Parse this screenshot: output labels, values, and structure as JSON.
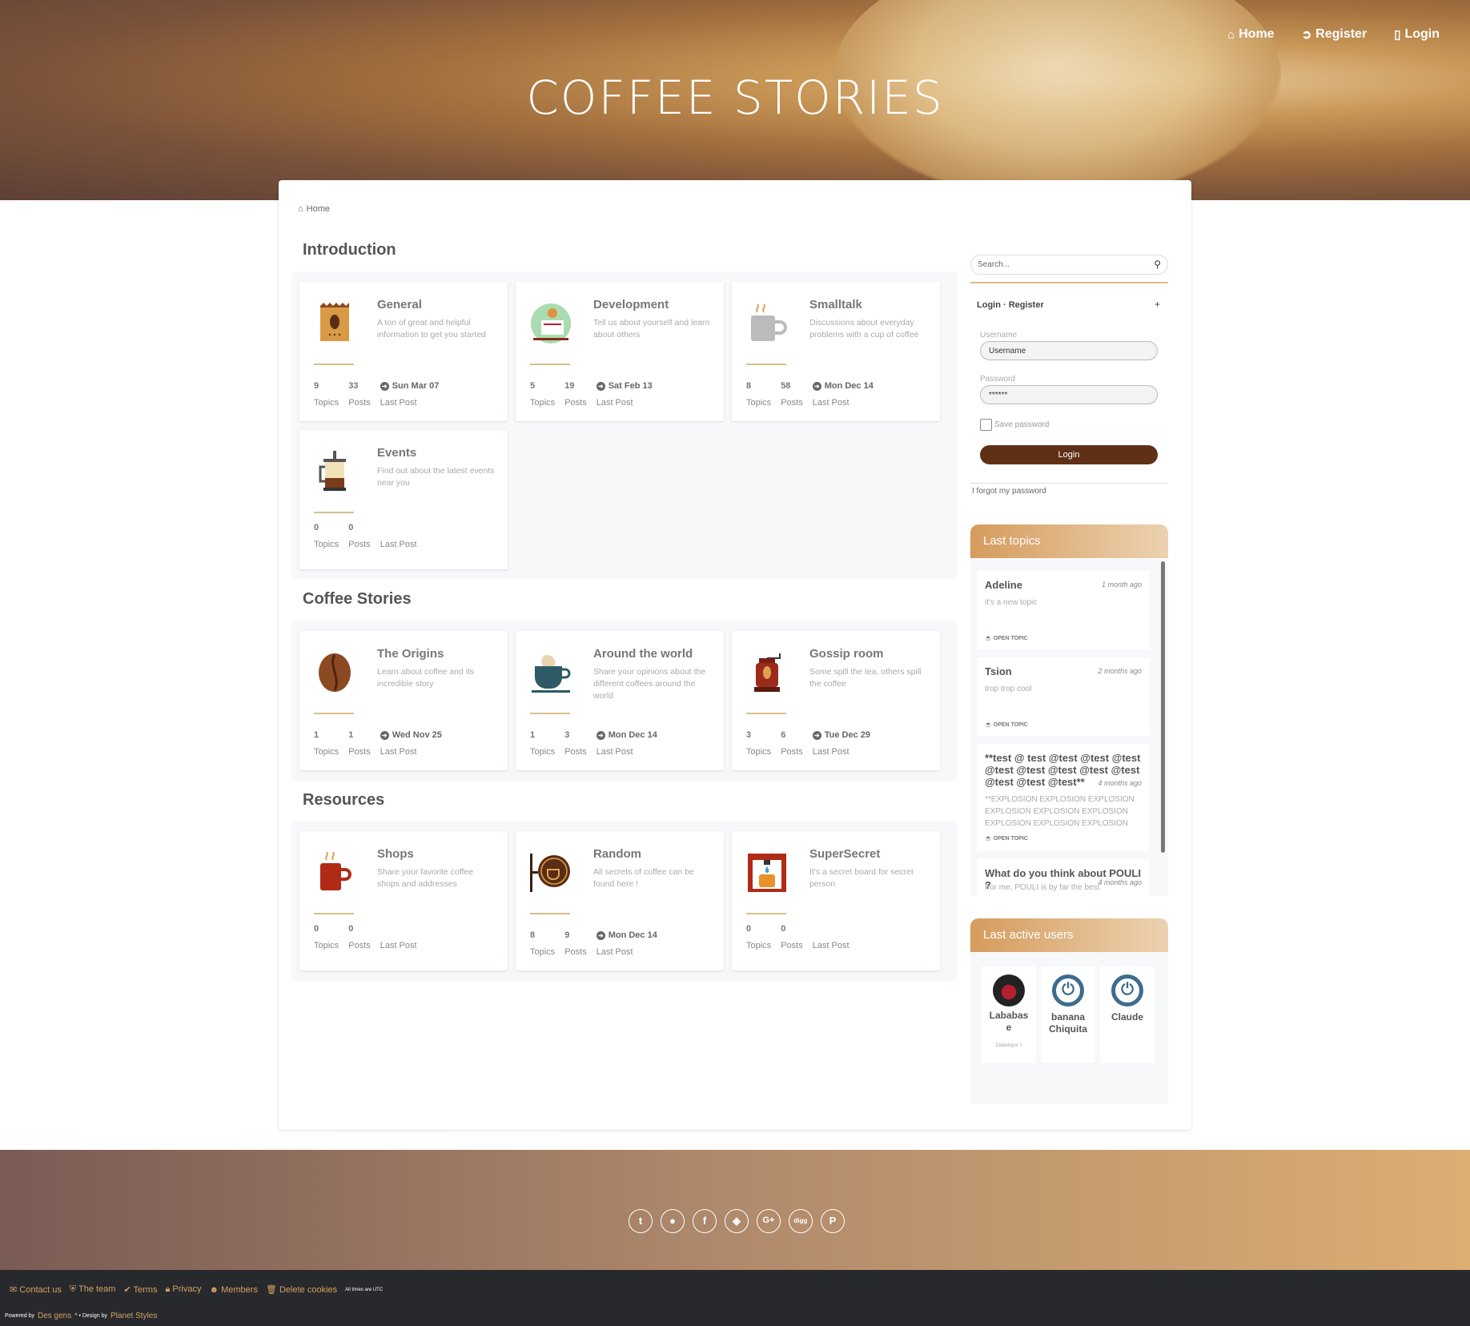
{
  "site": {
    "title": "COFFEE STORIES"
  },
  "nav": [
    {
      "label": "Home",
      "icon": "home-icon"
    },
    {
      "label": "Register",
      "icon": "register-icon"
    },
    {
      "label": "Login",
      "icon": "clipboard-icon"
    }
  ],
  "breadcrumb": {
    "label": "Home"
  },
  "categories": [
    {
      "title": "Introduction",
      "forums": [
        {
          "name": "General",
          "desc": "A ton of great and helpful information to get you started",
          "topics": "9",
          "posts": "33",
          "last": "Sun Mar 07",
          "icon": "coffee-bag-icon"
        },
        {
          "name": "Development",
          "desc": "Tell us about yourself and learn about others",
          "topics": "5",
          "posts": "19",
          "last": "Sat Feb 13",
          "icon": "newspaper-reader-icon"
        },
        {
          "name": "Smalltalk",
          "desc": "Discussions about everyday problems with a cup of coffee",
          "topics": "8",
          "posts": "58",
          "last": "Mon Dec 14",
          "icon": "mug-icon"
        },
        {
          "name": "Events",
          "desc": "Find out about the latest events near you",
          "topics": "0",
          "posts": "0",
          "last": "",
          "icon": "french-press-icon"
        }
      ]
    },
    {
      "title": "Coffee Stories",
      "forums": [
        {
          "name": "The Origins",
          "desc": "Learn about coffee and its incredible story",
          "topics": "1",
          "posts": "1",
          "last": "Wed Nov 25",
          "icon": "coffee-bean-icon"
        },
        {
          "name": "Around the world",
          "desc": "Share your opinions about the different coffees around the world",
          "topics": "1",
          "posts": "3",
          "last": "Mon Dec 14",
          "icon": "cappuccino-cup-icon"
        },
        {
          "name": "Gossip room",
          "desc": "Some spill the tea, others spill the coffee",
          "topics": "3",
          "posts": "6",
          "last": "Tue Dec 29",
          "icon": "coffee-grinder-icon"
        }
      ]
    },
    {
      "title": "Resources",
      "forums": [
        {
          "name": "Shops",
          "desc": "Share your favorite coffee shops and addresses",
          "topics": "0",
          "posts": "0",
          "last": "",
          "icon": "red-mug-icon"
        },
        {
          "name": "Random",
          "desc": "All secrets of coffee can be found here !",
          "topics": "8",
          "posts": "9",
          "last": "Mon Dec 14",
          "icon": "cafe-sign-icon"
        },
        {
          "name": "SuperSecret",
          "desc": "It's a secret board for secret person",
          "topics": "0",
          "posts": "0",
          "last": "",
          "icon": "coffee-machine-icon"
        }
      ]
    }
  ],
  "labels": {
    "topics": "Topics",
    "posts": "Posts",
    "last_post": "Last Post"
  },
  "search": {
    "placeholder": "Search..."
  },
  "login": {
    "head": "Login · Register",
    "plus": "+",
    "username_label": "Username",
    "username_value": "Username",
    "password_label": "Password",
    "password_value": "******",
    "save": "Save password",
    "button": "Login",
    "forgot": "I forgot my password"
  },
  "last_topics": {
    "title": "Last topics",
    "items": [
      {
        "author": "Adeline",
        "when": "1 month ago",
        "text": "it's a new topic",
        "tag": "OPEN TOPIC"
      },
      {
        "author": "Tsion",
        "when": "2 months ago",
        "text": "trop trop cool",
        "tag": "OPEN TOPIC"
      },
      {
        "author": "**test @ test @test @test @test @test @test @test @test @test @test @test @test**",
        "when": "4 months ago",
        "text": "**EXPLOSION EXPLOSION EXPLOSION EXPLOSION EXPLOSION EXPLOSION EXPLOSION EXPLOSION EXPLOSION",
        "tag": "OPEN TOPIC"
      },
      {
        "author": "What do you think about POULI ?",
        "when": "4 months ago",
        "text": "For me, POULI is by far the best",
        "tag": ""
      }
    ]
  },
  "last_users": {
    "title": "Last active users",
    "users": [
      {
        "name": "Lababase",
        "title": "Diabolique !!"
      },
      {
        "name": "banana Chiquita",
        "title": ""
      },
      {
        "name": "Claude",
        "title": ""
      }
    ]
  },
  "social": [
    {
      "icon": "twitter-icon",
      "glyph": "t"
    },
    {
      "icon": "apple-icon",
      "glyph": ""
    },
    {
      "icon": "facebook-icon",
      "glyph": "f"
    },
    {
      "icon": "codepen-icon",
      "glyph": "◈"
    },
    {
      "icon": "google-plus-icon",
      "glyph": "G+"
    },
    {
      "icon": "digg-icon",
      "glyph": "digg"
    },
    {
      "icon": "pinterest-icon",
      "glyph": "P"
    }
  ],
  "footer": {
    "links": [
      "Contact us",
      "The team",
      "Terms",
      "Privacy",
      "Members",
      "Delete cookies"
    ],
    "times": "All times are UTC",
    "powered": "Powered by",
    "powered_by": "Des gens",
    "design": "^ • Design by",
    "designer": "Planet Styles"
  },
  "colors": {
    "accent": "#d9bd8d",
    "brown": "#5f3015",
    "link": "#d4a160"
  }
}
